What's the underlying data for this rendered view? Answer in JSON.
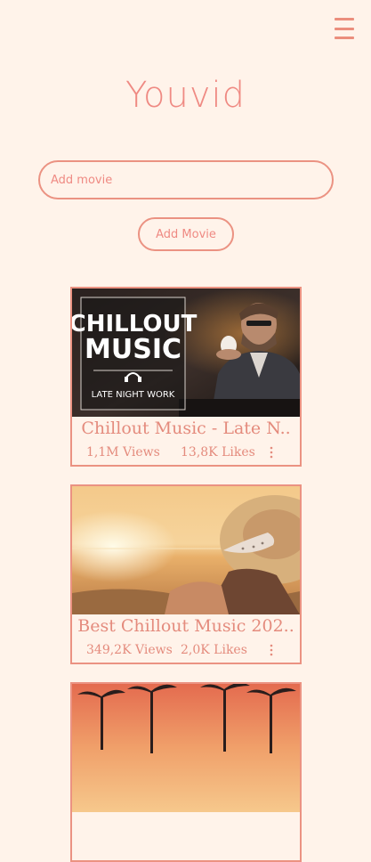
{
  "header": {
    "menu_icon": "hamburger-menu-icon",
    "logo": "Youvid"
  },
  "search": {
    "placeholder": "Add movie",
    "value": ""
  },
  "add_button": {
    "label": "Add Movie"
  },
  "videos": [
    {
      "thumb_text": {
        "line1": "CHILLOUT",
        "line2": "MUSIC",
        "line3": "LATE NIGHT WORK"
      },
      "title": "Chillout Music - Late N..",
      "views": "1,1M Views",
      "likes": "13,8K Likes",
      "more_icon": "more-vertical-icon"
    },
    {
      "title": "Best Chillout Music 202..",
      "views": "349,2K Views",
      "likes": "2,0K Likes",
      "more_icon": "more-vertical-icon"
    },
    {
      "title": "",
      "views": "",
      "likes": ""
    }
  ],
  "colors": {
    "background": "#fff3ea",
    "accent": "#eb9282",
    "text": "#e48b7d"
  }
}
